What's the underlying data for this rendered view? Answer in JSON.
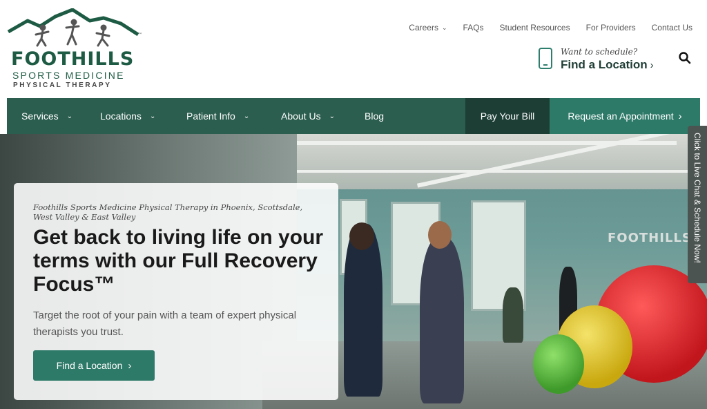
{
  "logo": {
    "name": "FOOTHILLS",
    "line1": "SPORTS MEDICINE",
    "line2": "PHYSICAL THERAPY",
    "tm": "™"
  },
  "utility_nav": {
    "items": [
      "Careers",
      "FAQs",
      "Student Resources",
      "For Providers",
      "Contact Us"
    ]
  },
  "schedule": {
    "want": "Want to schedule?",
    "find": "Find a Location"
  },
  "main_nav": {
    "items": [
      "Services",
      "Locations",
      "Patient Info",
      "About Us",
      "Blog"
    ],
    "pay_bill": "Pay Your Bill",
    "request": "Request an Appointment"
  },
  "hero": {
    "kicker": "Foothills Sports Medicine Physical Therapy in Phoenix, Scottsdale, West Valley & East Valley",
    "title": "Get back to living life on your terms with our Full Recovery Focus™",
    "text": "Target the root of your pain with a team of expert physical therapists you trust.",
    "button": "Find a Location",
    "wall_logo": "FOOTHILLS"
  },
  "chat_tab": "Click to Live Chat & Schedule Now!",
  "colors": {
    "brand_green": "#2c5e4f",
    "accent_teal": "#2e7a69",
    "dark_green": "#1d3e35"
  }
}
